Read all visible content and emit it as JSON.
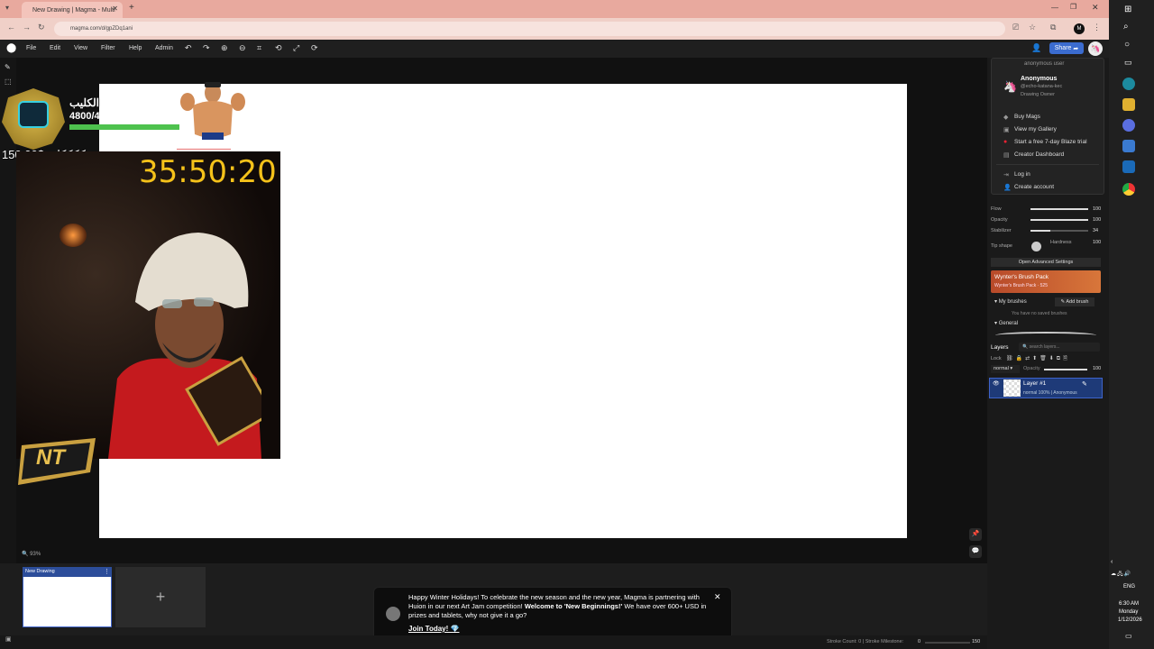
{
  "browser": {
    "tab_title": "New Drawing | Magma - Multi",
    "url": "magma.com/d/gpZDq1ani",
    "profile_initial": "M",
    "colors": {
      "tabbar": "#e8a99e",
      "addrbar": "#f0d0c8"
    }
  },
  "app": {
    "menu": [
      "File",
      "Edit",
      "View",
      "Filter",
      "Help",
      "Admin"
    ],
    "share_label": "Share",
    "zoom": "93%"
  },
  "overlay": {
    "name": "الكليب",
    "points": "4800/4800",
    "points_fraction": 1.0,
    "money": "150.00$ :ككككك",
    "timer": "35:50:20",
    "logo_text": "NT"
  },
  "user_menu": {
    "header": "anonymous user",
    "name": "Anonymous",
    "handle": "@echo-katana-kec",
    "role": "Drawing Owner",
    "items": [
      "Buy Mags",
      "View my Gallery",
      "Start a free 7-day Blaze trial",
      "Creator Dashboard",
      "Log in",
      "Create account"
    ]
  },
  "brush": {
    "rows": [
      {
        "label": "Flow",
        "value": "100",
        "fraction": 1.0
      },
      {
        "label": "Opacity",
        "value": "100",
        "fraction": 1.0
      },
      {
        "label": "Stabilizer",
        "value": "34",
        "fraction": 0.34
      }
    ],
    "tip_label": "Tip shape",
    "hardness_label": "Hardness",
    "hardness_value": "100",
    "advanced_label": "Open Advanced Settings",
    "pack_title": "Wynter's Brush Pack",
    "pack_sub": "Wynter's Brush Pack · 525",
    "my_brushes": "My brushes",
    "add_brush": "Add brush",
    "no_brushes": "You have no saved brushes",
    "general": "General"
  },
  "layers": {
    "title": "Layers",
    "search_placeholder": "search layers...",
    "lock": "Lock",
    "blend": "normal",
    "opacity_label": "Opacity",
    "opacity_value": "100",
    "layer_name": "Layer #1",
    "layer_meta": "normal 100% | Anonymous"
  },
  "bottom": {
    "thumb_title": "New Drawing",
    "add_symbol": "+",
    "stroke_count": "Stroke Count: 0 | Stroke Milestone:",
    "milestone_start": "0",
    "milestone_end": "150"
  },
  "toast": {
    "text_a": "Happy Winter Holidays! To celebrate the new season and the new year, Magma is partnering with Huion in our next Art Jam competition! ",
    "text_b": "Welcome to 'New Beginnings!'",
    "text_c": " We have over 600+ USD in prizes and tablets, why not give it a go?",
    "join": "Join Today! 💎"
  },
  "taskbar": {
    "lang": "ENG",
    "time": "6:30 AM",
    "day": "Monday",
    "date": "1/12/2026"
  }
}
